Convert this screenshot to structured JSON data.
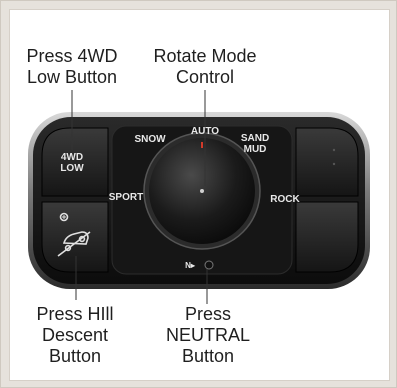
{
  "callouts": {
    "four_wd_low": {
      "line1": "Press 4WD",
      "line2": "Low Button"
    },
    "rotate_mode": {
      "line1": "Rotate Mode",
      "line2": "Control"
    },
    "hill_descent": {
      "line1": "Press HIll",
      "line2": "Descent",
      "line3": "Button"
    },
    "neutral": {
      "line1": "Press",
      "line2": "NEUTRAL",
      "line3": "Button"
    }
  },
  "panel_labels": {
    "four_wd_low": {
      "line1": "4WD",
      "line2": "LOW"
    },
    "snow": "SNOW",
    "auto": "AUTO",
    "sand_mud": {
      "line1": "SAND",
      "line2": "MUD"
    },
    "sport": "SPORT",
    "rock": "ROCK",
    "neutral": "N▸"
  },
  "colors": {
    "panel_body": "#1a1a1a",
    "chrome_rim": "#9a9a9a",
    "leader_line": "#333333",
    "knob_indicator": "#d23a2a"
  },
  "icons": {
    "hill_descent": "hill-descent-car-icon",
    "neutral_indicator": "neutral-indicator-light-icon"
  }
}
